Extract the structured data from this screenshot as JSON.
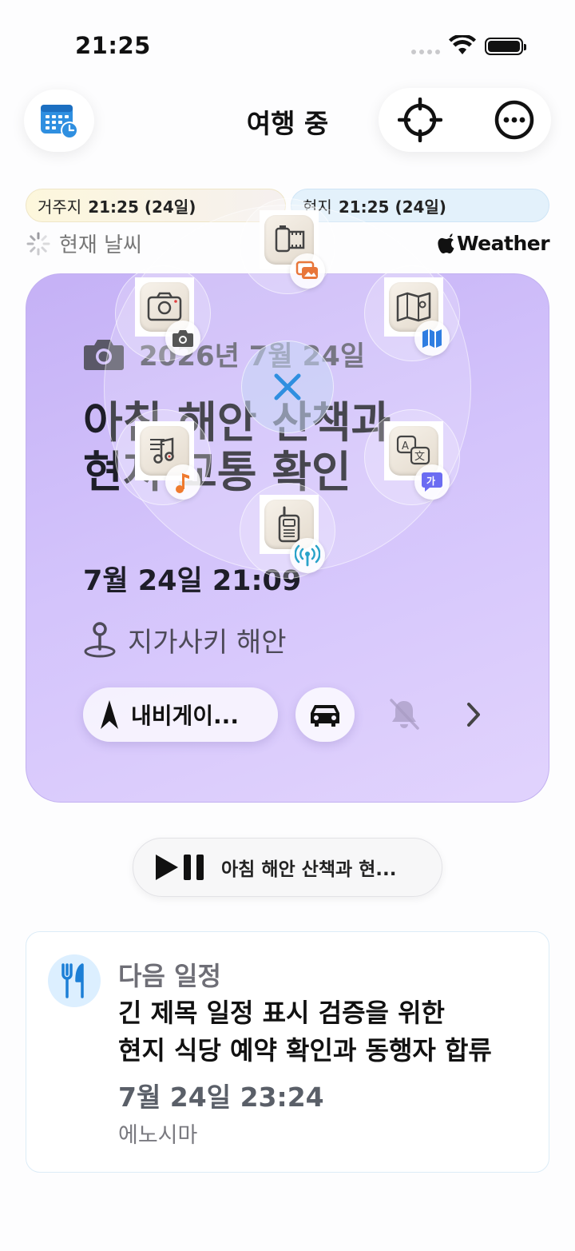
{
  "status_bar": {
    "time": "21:25"
  },
  "header": {
    "title": "여행 중"
  },
  "clocks": {
    "home_label": "거주지",
    "home_value": "21:25 (24일)",
    "local_label": "현지",
    "local_value": "21:25 (24일)"
  },
  "weather": {
    "label": "현재 날씨",
    "provider": "Weather"
  },
  "current_event": {
    "date": "2026년 7월 24일",
    "title_line1": "아침 해안 산책과",
    "title_line2": "현지 교통 확인",
    "datetime": "7월 24일 21:09",
    "location": "지가사키 해안",
    "navigate_label": "내비게이...",
    "accent_color": "#c9b6f7"
  },
  "radial_menu": {
    "items": [
      {
        "name": "film",
        "badge_color": "#e8763a"
      },
      {
        "name": "camera-pro",
        "badge_color": "#555"
      },
      {
        "name": "map",
        "badge_color": "#2f7de1"
      },
      {
        "name": "music",
        "badge_color": "#ef7a2e"
      },
      {
        "name": "translate",
        "badge_color": "#6b6cf2"
      },
      {
        "name": "walkie-talkie",
        "badge_color": "#2aa3c9"
      }
    ],
    "close_color": "#2f8fe0"
  },
  "now_playing": {
    "text": "아침 해안 산책과 현..."
  },
  "next_schedule": {
    "label": "다음 일정",
    "title_line1": "긴 제목 일정 표시 검증을 위한",
    "title_line2": "현지 식당 예약 확인과 동행자 합류",
    "datetime": "7월 24일 23:24",
    "place": "에노시마"
  }
}
